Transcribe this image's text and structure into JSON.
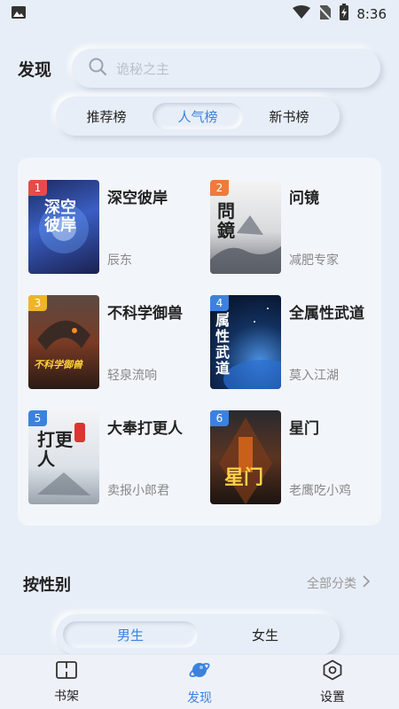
{
  "status_bar": {
    "time": "8:36"
  },
  "header": {
    "title": "发现",
    "search_placeholder": "诡秘之主"
  },
  "rank_tabs": [
    {
      "label": "推荐榜",
      "active": false
    },
    {
      "label": "人气榜",
      "active": true
    },
    {
      "label": "新书榜",
      "active": false
    }
  ],
  "books": [
    {
      "rank": "1",
      "title": "深空彼岸",
      "author": "辰东",
      "badge_color": "#e84a4a",
      "cover_text": "深空彼岸"
    },
    {
      "rank": "2",
      "title": "问镜",
      "author": "减肥专家",
      "badge_color": "#f07a3a",
      "cover_text": "問鏡"
    },
    {
      "rank": "3",
      "title": "不科学御兽",
      "author": "轻泉流响",
      "badge_color": "#f0b429",
      "cover_text": "不科学御兽"
    },
    {
      "rank": "4",
      "title": "全属性武道",
      "author": "莫入江湖",
      "badge_color": "#3b82e0",
      "cover_text": "属性武道"
    },
    {
      "rank": "5",
      "title": "大奉打更人",
      "author": "卖报小郎君",
      "badge_color": "#3b82e0",
      "cover_text": "打更人"
    },
    {
      "rank": "6",
      "title": "星门",
      "author": "老鹰吃小鸡",
      "badge_color": "#3b82e0",
      "cover_text": "星门"
    }
  ],
  "gender_section": {
    "title": "按性别",
    "all_categories": "全部分类",
    "tabs": [
      {
        "label": "男生",
        "active": true
      },
      {
        "label": "女生",
        "active": false
      }
    ]
  },
  "bottom_nav": [
    {
      "label": "书架",
      "icon": "book-icon",
      "active": false
    },
    {
      "label": "发现",
      "icon": "planet-icon",
      "active": true
    },
    {
      "label": "设置",
      "icon": "settings-icon",
      "active": false
    }
  ]
}
